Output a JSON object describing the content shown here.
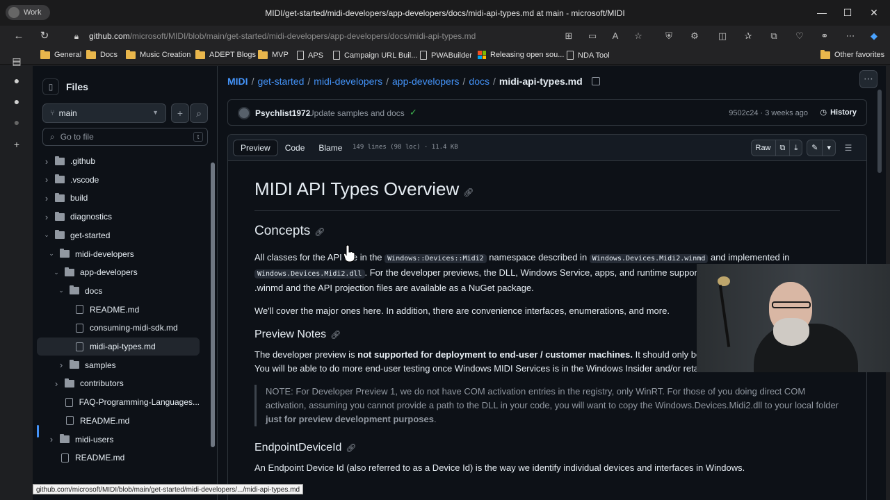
{
  "window": {
    "profile_label": "Work",
    "title": "MIDI/get-started/midi-developers/app-developers/docs/midi-api-types.md at main - microsoft/MIDI",
    "minimize_glyph": "—",
    "maximize_glyph": "☐",
    "close_glyph": "✕"
  },
  "addressbar": {
    "url_domain": "github.com",
    "url_path": "/microsoft/MIDI/blob/main/get-started/midi-developers/app-developers/docs/midi-api-types.md"
  },
  "favorites": [
    {
      "label": "General",
      "icon": "folder-icon"
    },
    {
      "label": "Docs",
      "icon": "folder-icon"
    },
    {
      "label": "Music Creation",
      "icon": "folder-icon"
    },
    {
      "label": "ADEPT Blogs",
      "icon": "folder-icon"
    },
    {
      "label": "MVP",
      "icon": "folder-icon"
    },
    {
      "label": "APS",
      "icon": "page-icon"
    },
    {
      "label": "Campaign URL Buil...",
      "icon": "page-icon"
    },
    {
      "label": "PWABuilder",
      "icon": "page-icon"
    },
    {
      "label": "Releasing open sou...",
      "icon": "microsoft-icon"
    },
    {
      "label": "NDA Tool",
      "icon": "page-icon"
    }
  ],
  "other_favorites": "Other favorites",
  "sidebar": {
    "title": "Files",
    "branch": "main",
    "search_placeholder": "Go to file",
    "search_kbd": "t",
    "tree": [
      {
        "label": ".github",
        "type": "folder",
        "depth": 0,
        "expanded": false
      },
      {
        "label": ".vscode",
        "type": "folder",
        "depth": 0,
        "expanded": false
      },
      {
        "label": "build",
        "type": "folder",
        "depth": 0,
        "expanded": false
      },
      {
        "label": "diagnostics",
        "type": "folder",
        "depth": 0,
        "expanded": false
      },
      {
        "label": "get-started",
        "type": "folder",
        "depth": 0,
        "expanded": true
      },
      {
        "label": "midi-developers",
        "type": "folder",
        "depth": 1,
        "expanded": true
      },
      {
        "label": "app-developers",
        "type": "folder",
        "depth": 2,
        "expanded": true
      },
      {
        "label": "docs",
        "type": "folder",
        "depth": 3,
        "expanded": true
      },
      {
        "label": "README.md",
        "type": "file",
        "depth": 4
      },
      {
        "label": "consuming-midi-sdk.md",
        "type": "file",
        "depth": 4
      },
      {
        "label": "midi-api-types.md",
        "type": "file",
        "depth": 4,
        "selected": true
      },
      {
        "label": "samples",
        "type": "folder",
        "depth": 3,
        "expanded": false
      },
      {
        "label": "contributors",
        "type": "folder",
        "depth": 2,
        "expanded": false
      },
      {
        "label": "FAQ-Programming-Languages...",
        "type": "file",
        "depth": 2
      },
      {
        "label": "README.md",
        "type": "file",
        "depth": 2
      },
      {
        "label": "midi-users",
        "type": "folder",
        "depth": 1,
        "expanded": false
      },
      {
        "label": "README.md",
        "type": "file",
        "depth": 1
      }
    ]
  },
  "breadcrumb": {
    "parts": [
      "MIDI",
      "get-started",
      "midi-developers",
      "app-developers",
      "docs"
    ],
    "current": "midi-api-types.md"
  },
  "commit": {
    "author": "Psychlist1972",
    "message": "Update samples and docs",
    "check": "✓",
    "meta": "9502c24 · 3 weeks ago",
    "history_label": "History"
  },
  "file": {
    "tabs": [
      "Preview",
      "Code",
      "Blame"
    ],
    "active_tab": "Preview",
    "info": "149 lines (98 loc) · 11.4 KB",
    "raw_label": "Raw"
  },
  "readme": {
    "h1": "MIDI API Types Overview",
    "concepts_h": "Concepts",
    "p1_a": "All classes for the API are in the ",
    "p1_code1": "Windows::Devices::Midi2",
    "p1_b": " namespace described in ",
    "p1_code2": "Windows.Devices.Midi2.winmd",
    "p1_c": " and implemented in ",
    "p1_code3": "Windows.Devices.Midi2.dll",
    "p1_d": ". For the developer previews, the DLL, Windows Service, apps, and runtime support are included in the installer. The .winmd and the API projection files are available as a NuGet package.",
    "p2": "We'll cover the major ones here. In addition, there are convenience interfaces, enumerations, and more.",
    "preview_h": "Preview Notes",
    "p3_a": "The developer preview is ",
    "p3_b": "not supported for deployment to end-user / customer machines.",
    "p3_c": " It should only be used on development machines. You will be able to do more end-user testing once Windows MIDI Services is in the Windows Insider and/or retail builds of Windows.",
    "note_a": "NOTE: For Developer Preview 1, we do not have COM activation entries in the registry, only WinRT. For those of you doing direct COM activation, assuming you cannot provide a path to the DLL in your code, you will want to copy the Windows.Devices.Midi2.dll to your local folder ",
    "note_b": "just for preview development purposes",
    "note_c": ".",
    "endpoint_h": "EndpointDeviceId",
    "p4": "An Endpoint Device Id (also referred to as a Device Id) is the way we identify individual devices and interfaces in Windows."
  },
  "status_url": "github.com/microsoft/MIDI/blob/main/get-started/midi-developers/.../midi-api-types.md"
}
